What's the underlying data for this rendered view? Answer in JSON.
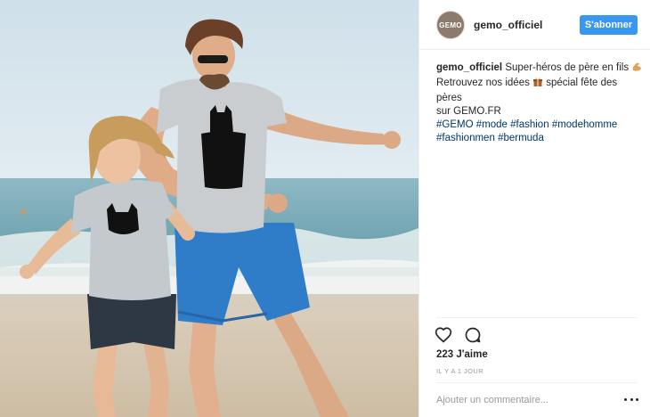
{
  "post": {
    "photo": {
      "alt": "",
      "shirt_father": [
        "MON PAPA",
        "EST UN",
        "SUPER HÉROS",
        "MAIS CHUT!",
        "C'EST UN SECRET"
      ],
      "shirt_son": [
        "MON PAPA",
        "SUPER HÉROS",
        "MAIS CHUT!",
        "C'EST UN SECRET"
      ]
    },
    "header": {
      "avatar_text": "GEMO",
      "username": "gemo_officiel",
      "follow_label": "S'abonner"
    },
    "caption": {
      "username": "gemo_officiel",
      "line1": "Super-héros de père en fils",
      "line2": "Retrouvez nos idées",
      "line3": "spécial fête des pères",
      "line4": "sur GEMO.FR",
      "hashtags": [
        "#GEMO",
        "#mode",
        "#fashion",
        "#modehomme",
        "#fashionmen",
        "#bermuda"
      ]
    },
    "icons": {
      "emoji1": "flexed-biceps-icon",
      "emoji2": "gift-box-icon",
      "like": "heart-icon",
      "comment": "comment-bubble-icon",
      "more": "ellipsis-icon"
    },
    "likes": "223 J'aime",
    "timestamp": "IL Y A 1 JOUR",
    "comment_placeholder": "Ajouter un commentaire...",
    "colors": {
      "accent": "#3897f0",
      "hashtag": "#003569",
      "muted": "#999999",
      "text": "#262626"
    }
  }
}
